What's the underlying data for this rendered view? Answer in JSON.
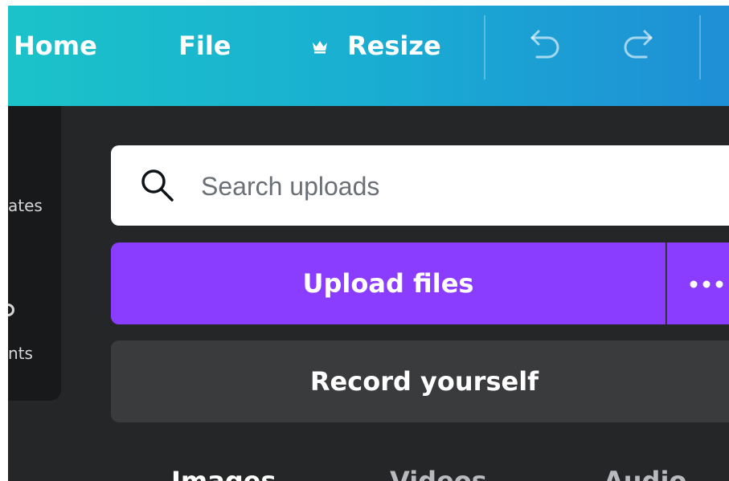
{
  "topbar": {
    "home_label": "Home",
    "file_label": "File",
    "resize_label": "Resize",
    "crown_icon": "crown-icon",
    "undo_icon": "undo-icon",
    "redo_icon": "redo-icon"
  },
  "sidebar": {
    "items": [
      {
        "label": "ates"
      },
      {
        "label": "nts"
      }
    ]
  },
  "search": {
    "placeholder": "Search uploads",
    "icon": "search-icon"
  },
  "buttons": {
    "upload_label": "Upload files",
    "more_icon": "more-horizontal-icon",
    "record_label": "Record yourself"
  },
  "tabs": [
    {
      "label": "Images"
    },
    {
      "label": "Videos"
    },
    {
      "label": "Audio"
    }
  ],
  "colors": {
    "topbar_start": "#1bc3c9",
    "topbar_end": "#1f8fd6",
    "workspace": "#252627",
    "accent_purple": "#8b3dff",
    "record_button": "#3a3b3d"
  }
}
